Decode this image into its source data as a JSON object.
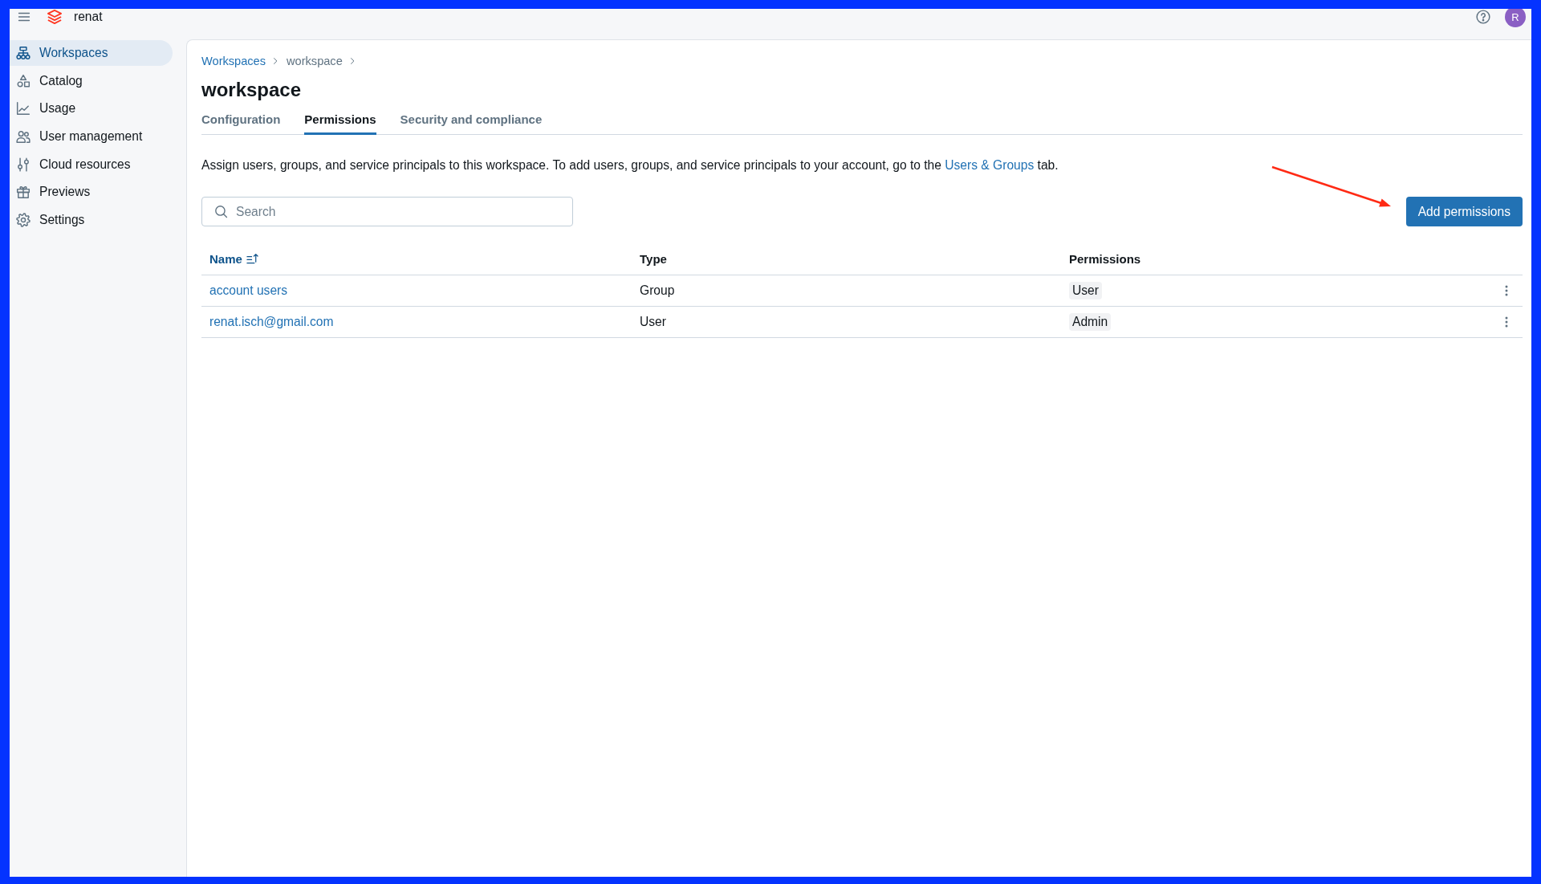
{
  "header": {
    "account_name": "renat",
    "avatar_initial": "R"
  },
  "sidebar": {
    "items": [
      {
        "label": "Workspaces",
        "selected": true
      },
      {
        "label": "Catalog",
        "selected": false
      },
      {
        "label": "Usage",
        "selected": false
      },
      {
        "label": "User management",
        "selected": false
      },
      {
        "label": "Cloud resources",
        "selected": false
      },
      {
        "label": "Previews",
        "selected": false
      },
      {
        "label": "Settings",
        "selected": false
      }
    ]
  },
  "breadcrumbs": [
    {
      "label": "Workspaces",
      "kind": "link"
    },
    {
      "label": "workspace",
      "kind": "current"
    }
  ],
  "page_title": "workspace",
  "tabs": [
    {
      "label": "Configuration",
      "selected": false
    },
    {
      "label": "Permissions",
      "selected": true
    },
    {
      "label": "Security and compliance",
      "selected": false
    }
  ],
  "description": {
    "text": "Assign users, groups, and service principals to this workspace. To add users, groups, and service principals to your account, go to the",
    "link": "Users & Groups",
    "text_after": "tab."
  },
  "search": {
    "placeholder": "Search"
  },
  "add_button": {
    "label": "Add permissions"
  },
  "table": {
    "columns": [
      {
        "label": "Name",
        "sorted": true
      },
      {
        "label": "Type",
        "sorted": false
      },
      {
        "label": "Permissions",
        "sorted": false
      }
    ],
    "rows": [
      {
        "name": "account users",
        "type": "Group",
        "permission": "User"
      },
      {
        "name": "renat.isch@gmail.com",
        "type": "User",
        "permission": "Admin"
      }
    ]
  }
}
